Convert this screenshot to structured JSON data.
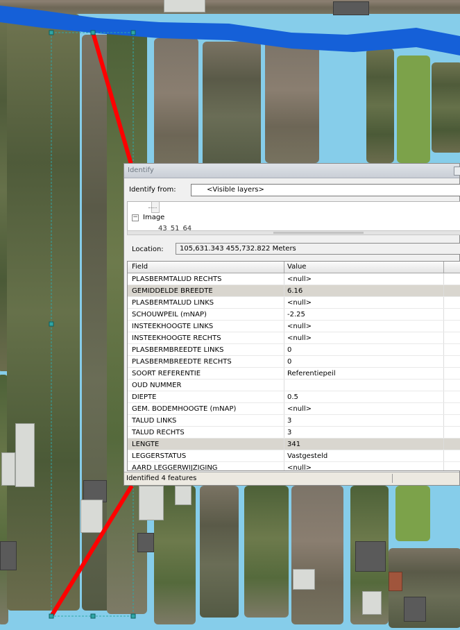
{
  "window": {
    "title": "Identify",
    "identify_from_label": "Identify from:",
    "identify_from_value": "<Visible layers>"
  },
  "tree": {
    "node_label": "Image",
    "child_label": "43_51_64",
    "toggle": "−"
  },
  "location": {
    "label": "Location:",
    "value": "105,631.343  455,732.822 Meters"
  },
  "table": {
    "headers": {
      "field": "Field",
      "value": "Value"
    },
    "rows": [
      {
        "field": "PLASBERMTALUD RECHTS",
        "value": "<null>",
        "selected": false
      },
      {
        "field": "GEMIDDELDE BREEDTE",
        "value": "6.16",
        "selected": true
      },
      {
        "field": "PLASBERMTALUD LINKS",
        "value": "<null>",
        "selected": false
      },
      {
        "field": "SCHOUWPEIL (mNAP)",
        "value": "-2.25",
        "selected": false
      },
      {
        "field": "INSTEEKHOOGTE LINKS",
        "value": "<null>",
        "selected": false
      },
      {
        "field": "INSTEEKHOOGTE RECHTS",
        "value": "<null>",
        "selected": false
      },
      {
        "field": "PLASBERMBREEDTE LINKS",
        "value": "0",
        "selected": false
      },
      {
        "field": "PLASBERMBREEDTE RECHTS",
        "value": "0",
        "selected": false
      },
      {
        "field": "SOORT REFERENTIE",
        "value": "Referentiepeil",
        "selected": false
      },
      {
        "field": "OUD NUMMER",
        "value": "",
        "selected": false
      },
      {
        "field": "DIEPTE",
        "value": "0.5",
        "selected": false
      },
      {
        "field": "GEM. BODEMHOOGTE (mNAP)",
        "value": "<null>",
        "selected": false
      },
      {
        "field": "TALUD LINKS",
        "value": "3",
        "selected": false
      },
      {
        "field": "TALUD RECHTS",
        "value": "3",
        "selected": false
      },
      {
        "field": "LENGTE",
        "value": "341",
        "selected": true
      },
      {
        "field": "LEGGERSTATUS",
        "value": "Vastgesteld",
        "selected": false
      },
      {
        "field": "AARD LEGGERWIJZIGING",
        "value": "<null>",
        "selected": false
      }
    ]
  },
  "status": {
    "text": "Identified 4 features"
  },
  "colors": {
    "water": "#86cdea",
    "river": "#1560d8",
    "selection_line": "#ff0000",
    "selection_box": "#2fa6a6"
  }
}
